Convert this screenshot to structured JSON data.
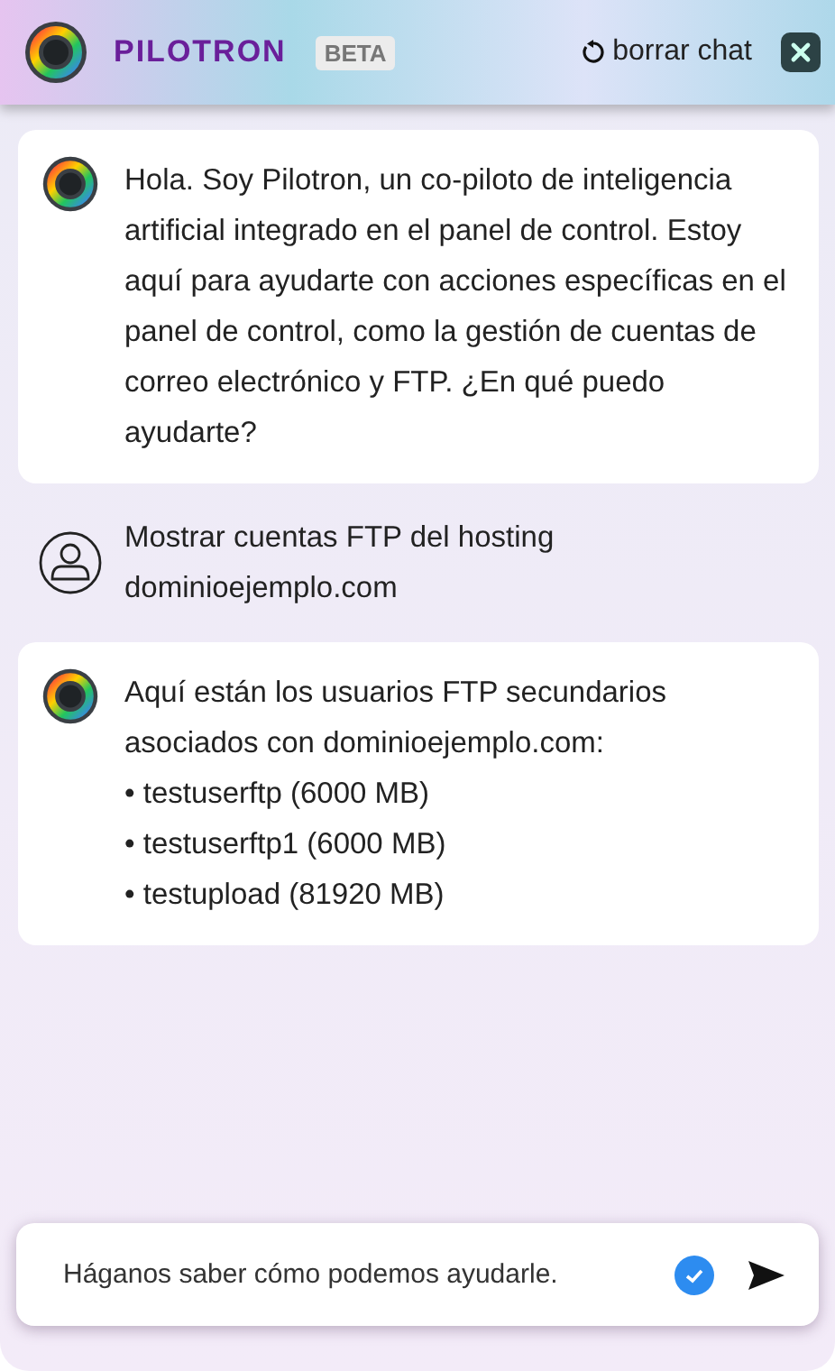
{
  "header": {
    "title": "PILOTRON",
    "badge": "BETA",
    "clear_label": "borrar chat"
  },
  "messages": [
    {
      "kind": "bot",
      "text": "Hola. Soy Pilotron, un co-piloto de inteligencia artificial integrado en el panel de control. Estoy aquí para ayudarte con acciones específicas en el panel de control, como la gestión de cuentas de correo electrónico y FTP. ¿En qué puedo ayudarte?"
    },
    {
      "kind": "user",
      "text": "Mostrar cuentas FTP del hosting dominioejemplo.com"
    },
    {
      "kind": "bot",
      "text": "Aquí están los usuarios FTP secundarios asociados con dominioejemplo.com:",
      "items": [
        "• testuserftp (6000 MB)",
        "• testuserftp1 (6000 MB)",
        "• testupload (81920 MB)"
      ]
    }
  ],
  "composer": {
    "placeholder": "Háganos saber cómo podemos ayudarle."
  }
}
